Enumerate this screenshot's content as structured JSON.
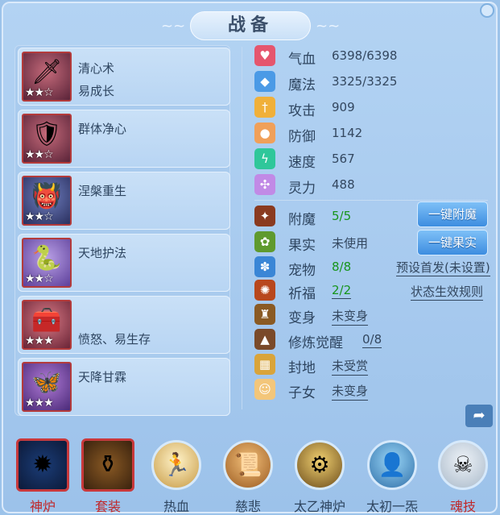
{
  "header": {
    "title": "战备"
  },
  "skills": [
    {
      "icon": "sword-spirit-icon",
      "line1": "清心术",
      "line2": "易成长",
      "stars": "★★☆"
    },
    {
      "icon": "red-armor-icon",
      "line1": "群体净心",
      "line2": "",
      "stars": "★★☆"
    },
    {
      "icon": "demon-mask-icon",
      "line1": "涅槃重生",
      "line2": "",
      "stars": "★★☆"
    },
    {
      "icon": "golden-snake-icon",
      "line1": "天地护法",
      "line2": "",
      "stars": "★★☆"
    },
    {
      "icon": "treasure-chest-icon",
      "line1": "",
      "line2": "愤怒、易生存",
      "stars": "★★★"
    },
    {
      "icon": "purple-guardian-icon",
      "line1": "天降甘霖",
      "line2": "",
      "stars": "★★★"
    }
  ],
  "stats": [
    {
      "icon": "heart-icon",
      "label": "气血",
      "value": "6398/6398"
    },
    {
      "icon": "mana-drop-icon",
      "label": "魔法",
      "value": "3325/3325"
    },
    {
      "icon": "attack-icon",
      "label": "攻击",
      "value": "909"
    },
    {
      "icon": "defense-icon",
      "label": "防御",
      "value": "1142"
    },
    {
      "icon": "speed-icon",
      "label": "速度",
      "value": "567"
    },
    {
      "icon": "spirit-icon",
      "label": "灵力",
      "value": "488"
    }
  ],
  "equip": [
    {
      "icon": "enchant-icon",
      "label": "附魔",
      "value": "5/5"
    },
    {
      "icon": "fruit-icon",
      "label": "果实",
      "value": "未使用"
    },
    {
      "icon": "pet-paw-icon",
      "label": "宠物",
      "value": "8/8"
    },
    {
      "icon": "blessing-icon",
      "label": "祈福",
      "value": "2/2"
    },
    {
      "icon": "transform-icon",
      "label": "变身",
      "value": "未变身"
    },
    {
      "icon": "cultivation-icon",
      "label": "修炼觉醒",
      "value": "0/8"
    },
    {
      "icon": "land-icon",
      "label": "封地",
      "value": "未受赏"
    },
    {
      "icon": "child-icon",
      "label": "子女",
      "value": "未变身"
    }
  ],
  "buttons": {
    "one_click_enchant": "一键附魔",
    "one_click_fruit": "一键果实",
    "preset_first": "预设首发(未设置)",
    "status_rules": "状态生效规则"
  },
  "bottom_tabs": [
    {
      "icon": "furnace-icon",
      "label": "神炉"
    },
    {
      "icon": "outfit-icon",
      "label": "套装"
    },
    {
      "icon": "blood-icon",
      "label": "热血"
    },
    {
      "icon": "mercy-icon",
      "label": "慈悲"
    },
    {
      "icon": "taiyi-furnace-icon",
      "label": "太乙神炉"
    },
    {
      "icon": "taichu-icon",
      "label": "太初一炁"
    },
    {
      "icon": "soul-skill-icon",
      "label": "魂技"
    }
  ],
  "colors": {
    "panel_bg": "#a6c9ee",
    "green_value": "#17951c",
    "selected_label": "#c0282a",
    "button_blue": "#3d8de0"
  }
}
